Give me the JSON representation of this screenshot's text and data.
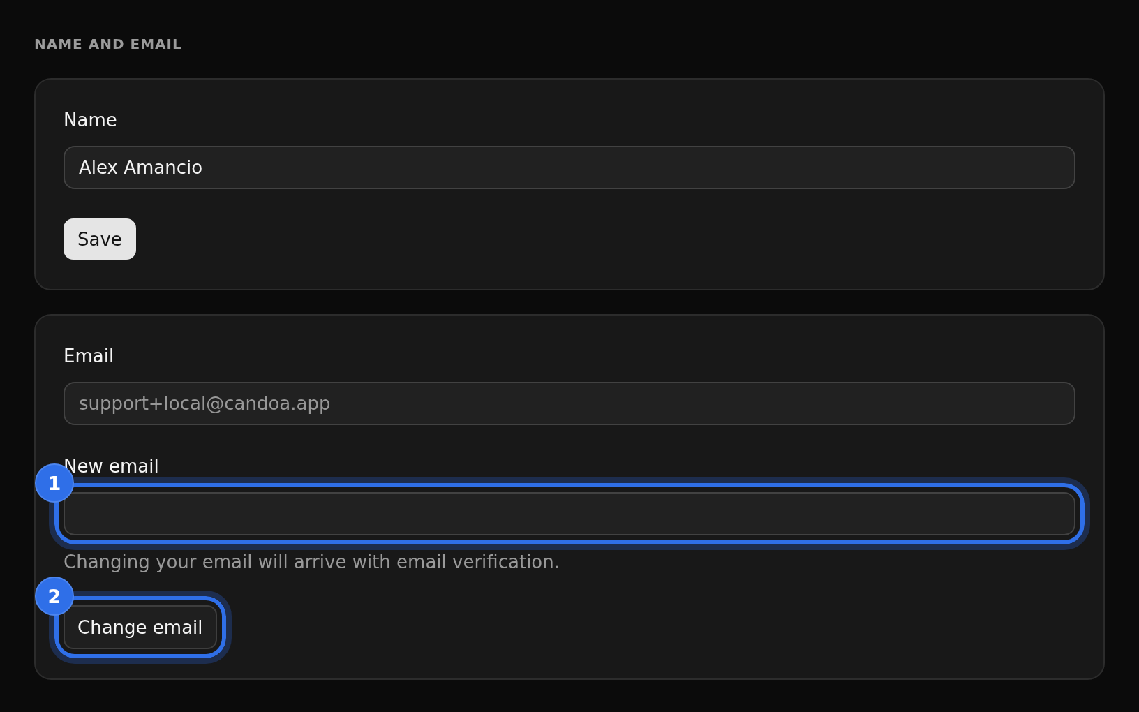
{
  "section_title": "NAME AND EMAIL",
  "cards": [
    {
      "items": [
        {
          "kind": "field",
          "label": "Name",
          "value": "Alex Amancio",
          "disabled": false
        },
        {
          "kind": "solid",
          "label": "Save"
        }
      ]
    },
    {
      "items": [
        {
          "kind": "field",
          "label": "Email",
          "value": "support+local@candoa.app",
          "disabled": true
        },
        {
          "kind": "field",
          "label": "New email",
          "callout": "1",
          "hint": "Changing your email will arrive with email verification."
        },
        {
          "kind": "outline",
          "label": "Change email",
          "callout": "2"
        }
      ]
    }
  ]
}
